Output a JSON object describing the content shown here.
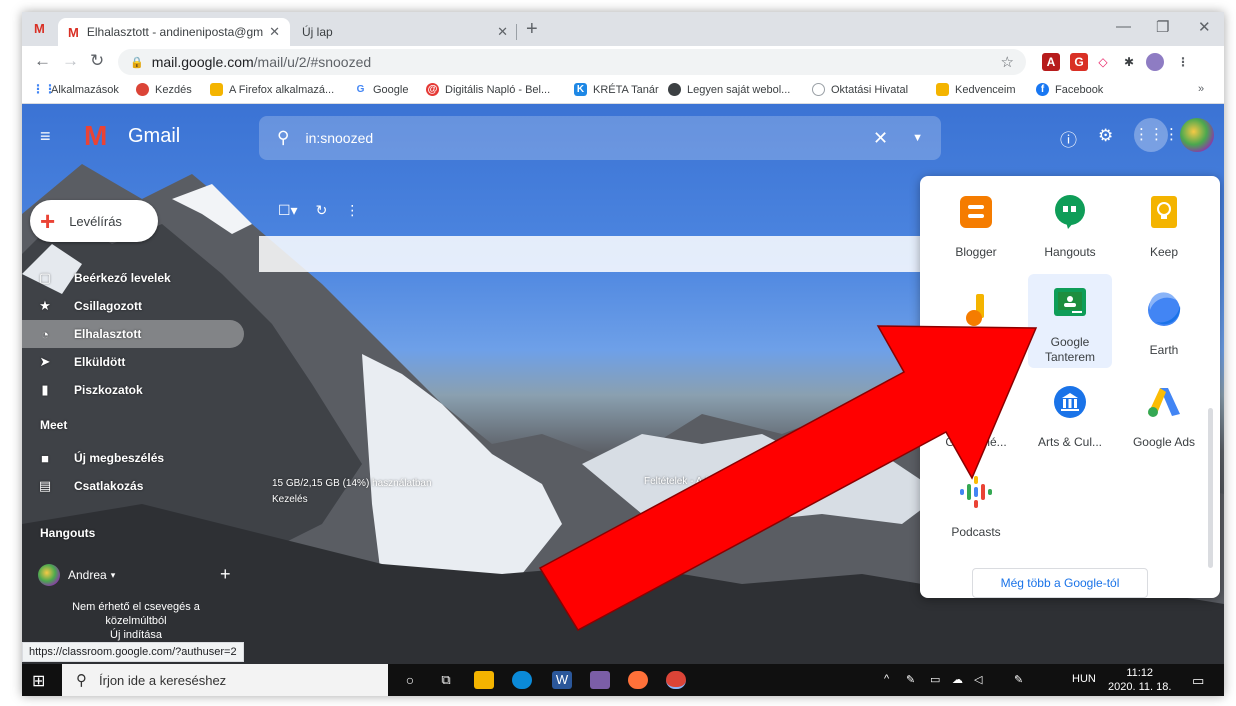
{
  "browser": {
    "active_tab_title": "Elhalasztott - andineniposta@gm",
    "inactive_tab_title": "Új lap",
    "url_host": "mail.google.com",
    "url_path": "/mail/u/2/#snoozed"
  },
  "bookmarks": [
    {
      "label": "Alkalmazások",
      "icon": "apps-grid-icon"
    },
    {
      "label": "Kezdés",
      "icon": "chrome-icon"
    },
    {
      "label": "A Firefox alkalmazá...",
      "icon": "folder-icon"
    },
    {
      "label": "Google",
      "icon": "google-icon"
    },
    {
      "label": "Digitális Napló - Bel...",
      "icon": "diary-icon"
    },
    {
      "label": "KRÉTA Tanár",
      "icon": "kreta-icon"
    },
    {
      "label": "Legyen saját webol...",
      "icon": "globe-icon"
    },
    {
      "label": "Oktatási Hivatal",
      "icon": "seal-icon"
    },
    {
      "label": "Kedvenceim",
      "icon": "folder-icon"
    },
    {
      "label": "Facebook",
      "icon": "facebook-icon"
    }
  ],
  "gmail": {
    "brand": "Gmail",
    "search_value": "in:snoozed",
    "compose_label": "Levélírás",
    "nav": [
      {
        "label": "Beérkező levelek",
        "icon": "inbox-icon"
      },
      {
        "label": "Csillagozott",
        "icon": "star-icon"
      },
      {
        "label": "Elhalasztott",
        "icon": "clock-icon"
      },
      {
        "label": "Elküldött",
        "icon": "send-icon"
      },
      {
        "label": "Piszkozatok",
        "icon": "draft-icon"
      }
    ],
    "meet_heading": "Meet",
    "meet": [
      {
        "label": "Új megbeszélés",
        "icon": "video-icon"
      },
      {
        "label": "Csatlakozás",
        "icon": "keyboard-icon"
      }
    ],
    "hangouts_heading": "Hangouts",
    "hangouts_user": "Andrea",
    "hangouts_note_1": "Nem érhető el csevegés a",
    "hangouts_note_2": "közelmúltból",
    "hangouts_note_3": "Új indítása",
    "storage_line": "15 GB/2,15 GB (14%) használatban",
    "storage_manage": "Kezelés",
    "details_text": "Feltételek - Adatvédelem",
    "status_url": "https://classroom.google.com/?authuser=2"
  },
  "apps_panel": {
    "apps": [
      {
        "label": "Blogger",
        "icon": "blogger-icon",
        "color": "#f57c00"
      },
      {
        "label": "Hangouts",
        "icon": "hangouts-icon",
        "color": "#0f9d58"
      },
      {
        "label": "Keep",
        "icon": "keep-icon",
        "color": "#f4b400"
      },
      {
        "label": "Jamboard",
        "icon": "jamboard-icon",
        "color": "#f4b400"
      },
      {
        "label": "Google Tanterem",
        "icon": "classroom-icon",
        "color": "#0f9d58"
      },
      {
        "label": "Earth",
        "icon": "earth-icon",
        "color": "#4285f4"
      },
      {
        "label": "Gyűjtemé...",
        "icon": "collections-icon",
        "color": "#db4437"
      },
      {
        "label": "Arts & Cul...",
        "icon": "arts-culture-icon",
        "color": "#1a73e8"
      },
      {
        "label": "Google Ads",
        "icon": "ads-icon",
        "color": "#4285f4"
      },
      {
        "label": "Podcasts",
        "icon": "podcasts-icon",
        "color": "#4285f4"
      }
    ],
    "more_label": "Még több a Google-tól"
  },
  "taskbar": {
    "search_placeholder": "Írjon ide a kereséshez",
    "language": "HUN",
    "time": "11:12",
    "date": "2020. 11. 18."
  },
  "colors": {
    "arrow_red": "#ff0000",
    "gmail_red": "#ea4335"
  }
}
